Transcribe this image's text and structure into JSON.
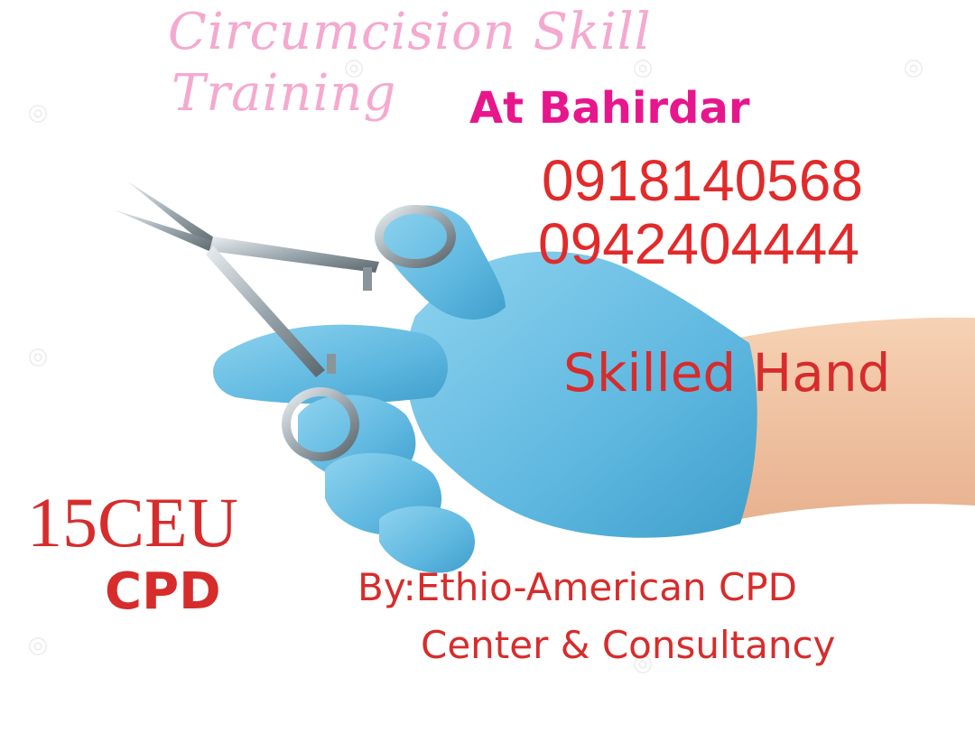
{
  "poster": {
    "title_line1": "Circumcision Skill",
    "title_line2": "Training",
    "location": "At Bahirdar",
    "phone_1": "0918140568",
    "phone_2": "0942404444",
    "tagline": "Skilled Hand",
    "ceu": "15CEU",
    "cpd": "CPD",
    "organizer_line1": "By:Ethio-American CPD",
    "organizer_line2": "Center & Consultancy"
  },
  "illustration": {
    "subject": "gloved-hand-holding-surgical-scissors-icon",
    "glove_color": "#6ec3e6",
    "skin_color": "#f3c9a6"
  },
  "colors": {
    "title": "#f5a9cf",
    "location": "#e8168c",
    "text_red": "#d72c2c"
  }
}
